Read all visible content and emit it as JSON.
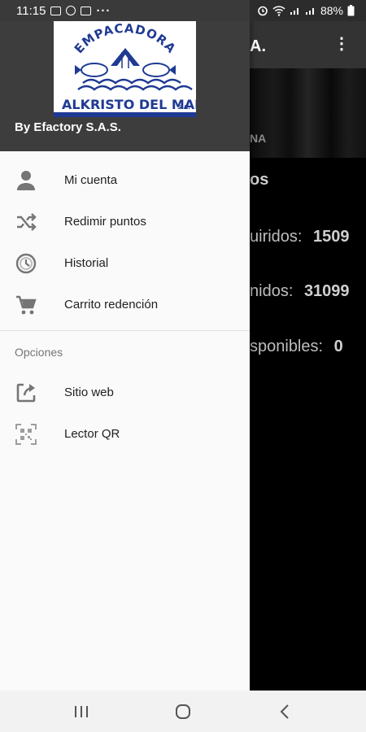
{
  "status_bar": {
    "time": "11:15",
    "dots": "···",
    "battery": "88%"
  },
  "background": {
    "title": "A.",
    "banner_text": "NA",
    "heading": "os",
    "rows": [
      {
        "label": "uiridos:",
        "value": "1509"
      },
      {
        "label": "nidos:",
        "value": "31099"
      },
      {
        "label": "sponibles:",
        "value": "0"
      }
    ]
  },
  "drawer": {
    "logo": {
      "top_text": "EMPACADORA",
      "bottom_text": "ALKRISTO DEL MAR",
      "suffix": "S.A."
    },
    "subtitle": "By Efactory S.A.S.",
    "menu": [
      {
        "label": "Mi cuenta",
        "icon": "person-icon"
      },
      {
        "label": "Redimir puntos",
        "icon": "shuffle-icon"
      },
      {
        "label": "Historial",
        "icon": "history-icon"
      },
      {
        "label": "Carrito redención",
        "icon": "cart-icon"
      }
    ],
    "section_label": "Opciones",
    "options": [
      {
        "label": "Sitio web",
        "icon": "open-in-new-icon"
      },
      {
        "label": "Lector QR",
        "icon": "qr-scanner-icon"
      }
    ]
  },
  "colors": {
    "header_bg": "#3d3d3d",
    "drawer_bg": "#fafafa",
    "icon_gray": "#757575",
    "logo_blue": "#1f3a93"
  }
}
